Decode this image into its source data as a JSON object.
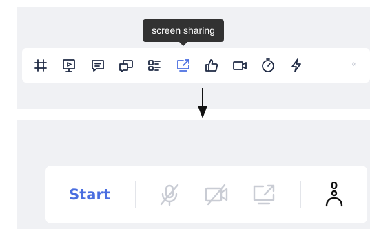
{
  "tooltip": {
    "text": "screen sharing"
  },
  "toolbar": {
    "items": [
      {
        "name": "layout-icon"
      },
      {
        "name": "presentation-icon"
      },
      {
        "name": "chat-icon"
      },
      {
        "name": "breakout-rooms-icon"
      },
      {
        "name": "agenda-list-icon"
      },
      {
        "name": "screen-share-icon",
        "active": true
      },
      {
        "name": "thumbs-up-icon"
      },
      {
        "name": "video-camera-icon"
      },
      {
        "name": "timer-icon"
      },
      {
        "name": "lightning-icon"
      }
    ],
    "collapse_label": "«"
  },
  "meeting_bar": {
    "start_label": "Start",
    "participant_count": "0",
    "controls": [
      {
        "name": "microphone-off-icon",
        "enabled": false
      },
      {
        "name": "camera-off-icon",
        "enabled": false
      },
      {
        "name": "screen-share-icon",
        "enabled": false
      }
    ]
  },
  "colors": {
    "accent": "#4a6ee0",
    "icon": "#1f2a44",
    "disabled": "#c9ccd4",
    "tooltip_bg": "#323232",
    "panel_bg": "#f0f1f4"
  }
}
